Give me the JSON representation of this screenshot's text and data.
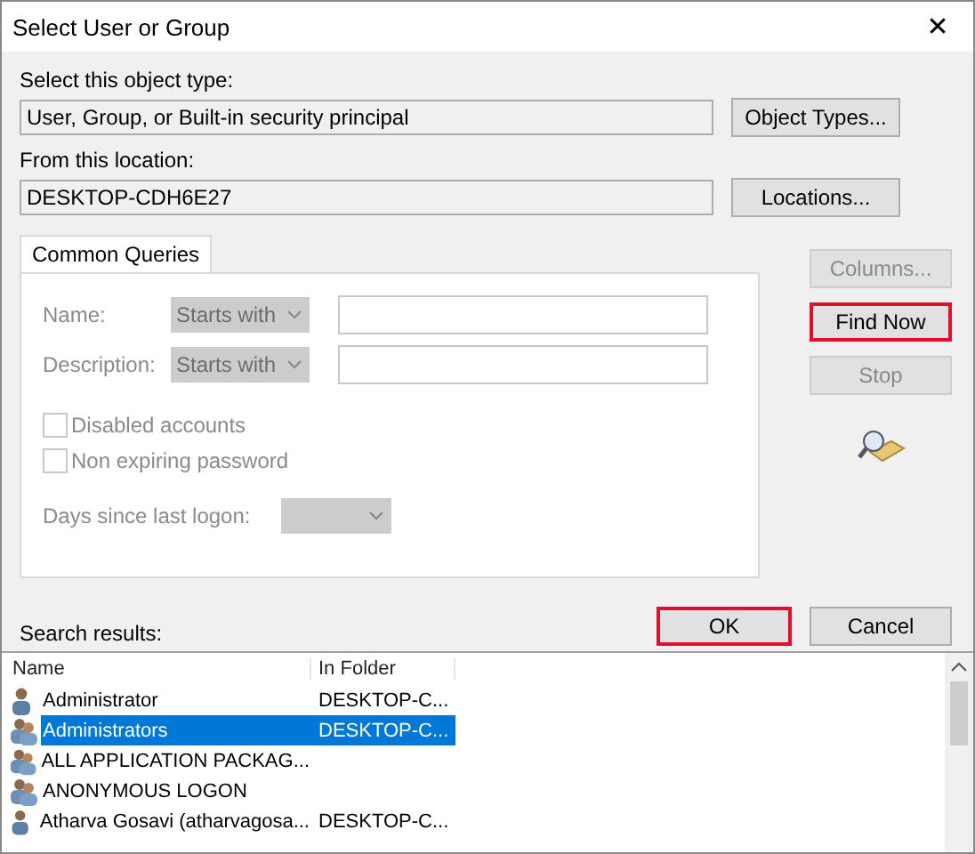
{
  "window": {
    "title": "Select User or Group",
    "close": "✕"
  },
  "object_type": {
    "label": "Select this object type:",
    "value": "User, Group, or Built-in security principal",
    "button": "Object Types..."
  },
  "location": {
    "label": "From this location:",
    "value": "DESKTOP-CDH6E27",
    "button": "Locations..."
  },
  "tabs": [
    {
      "label": "Common Queries",
      "selected": true
    }
  ],
  "queries": [
    {
      "label": "Name:",
      "mode": "Starts with"
    },
    {
      "label": "Description:",
      "mode": "Starts with"
    }
  ],
  "checkboxes": [
    {
      "label": "Disabled accounts",
      "checked": false
    },
    {
      "label": "Non expiring password",
      "checked": false
    }
  ],
  "days": {
    "label": "Days since last logon:"
  },
  "side_buttons": [
    {
      "label": "Columns...",
      "disabled": true,
      "highlighted": false
    },
    {
      "label": "Find Now",
      "disabled": false,
      "highlighted": true
    },
    {
      "label": "Stop",
      "disabled": true,
      "highlighted": false
    }
  ],
  "search_results_label": "Search results:",
  "buttons": [
    {
      "label": "OK",
      "highlighted": true
    },
    {
      "label": "Cancel",
      "highlighted": false
    }
  ],
  "table": {
    "columns": [
      "Name",
      "In Folder"
    ],
    "rows": [
      {
        "kind": "user",
        "name": "Administrator",
        "folder": "DESKTOP-C...",
        "selected": false
      },
      {
        "kind": "group",
        "name": "Administrators",
        "folder": "DESKTOP-C...",
        "selected": true
      },
      {
        "kind": "group",
        "name": "ALL APPLICATION PACKAG...",
        "folder": "",
        "selected": false
      },
      {
        "kind": "group",
        "name": "ANONYMOUS LOGON",
        "folder": "",
        "selected": false
      },
      {
        "kind": "user",
        "name": "Atharva Gosavi (atharvagosa...",
        "folder": "DESKTOP-C...",
        "selected": false
      }
    ]
  }
}
